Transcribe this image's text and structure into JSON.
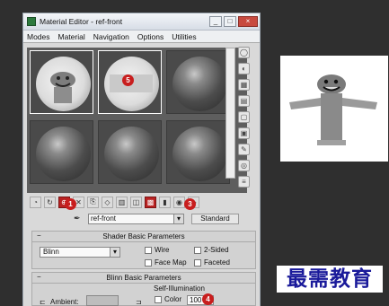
{
  "window": {
    "title": "Material Editor - ref-front",
    "controls": [
      "_",
      "□",
      "×"
    ]
  },
  "menu": [
    "Modes",
    "Material",
    "Navigation",
    "Options",
    "Utilities"
  ],
  "slots": [
    {
      "kind": "texture",
      "selected": true
    },
    {
      "kind": "texture",
      "selected": true
    },
    {
      "kind": "sphere",
      "selected": false
    },
    {
      "kind": "sphere",
      "selected": false
    },
    {
      "kind": "sphere",
      "selected": false
    },
    {
      "kind": "sphere",
      "selected": false
    }
  ],
  "annotations": {
    "slot": "5",
    "get_material": "1",
    "show_map": "3",
    "self_illum": "4"
  },
  "toolbar": {
    "icons": [
      "get-material-icon",
      "put-to-scene-icon",
      "assign-icon",
      "reset-icon",
      "copy-icon",
      "unique-icon",
      "put-to-library-icon",
      "material-effects-icon",
      "show-map-icon",
      "show-end-result-icon",
      "go-to-parent-icon",
      "go-forward-icon"
    ]
  },
  "name_row": {
    "material_name": "ref-front",
    "type_button": "Standard"
  },
  "shader_basic": {
    "header": "Shader Basic Parameters",
    "shader": "Blinn",
    "options": [
      "Wire",
      "2-Sided",
      "Face Map",
      "Faceted"
    ]
  },
  "blinn_basic": {
    "header": "Blinn Basic Parameters",
    "self_illum_label": "Self-Illumination",
    "ambient_label": "Ambient:",
    "color_label": "Color",
    "color_value": "100"
  },
  "brand": "最需教育",
  "colors": {
    "annotation": "#c81e1e",
    "brand": "#1a1a9a"
  }
}
